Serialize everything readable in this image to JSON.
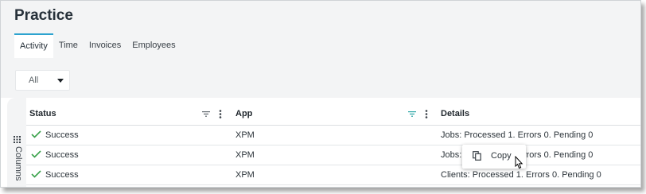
{
  "page": {
    "title": "Practice"
  },
  "tabs": [
    {
      "label": "Activity",
      "active": true
    },
    {
      "label": "Time"
    },
    {
      "label": "Invoices"
    },
    {
      "label": "Employees"
    }
  ],
  "filter": {
    "value": "All"
  },
  "columns_rail": {
    "label": "Columns",
    "icon": "grid-icon"
  },
  "grid": {
    "headers": [
      {
        "label": "Status"
      },
      {
        "label": "App"
      },
      {
        "label": "Details"
      }
    ],
    "rows": [
      {
        "status": "Success",
        "app": "XPM",
        "details": "Jobs: Processed 1. Errors 0. Pending 0"
      },
      {
        "status": "Success",
        "app": "XPM",
        "details": "Jobs: Processed 1. Errors 0. Pending 0"
      },
      {
        "status": "Success",
        "app": "XPM",
        "details": "Clients: Processed 1. Errors 0. Pending 0"
      }
    ]
  },
  "context_menu": {
    "copy_label": "Copy"
  },
  "colors": {
    "accent": "#2da3cf",
    "success": "#3aa24b",
    "filter_active": "#2aa5a5",
    "background": "#f3f4f5"
  }
}
